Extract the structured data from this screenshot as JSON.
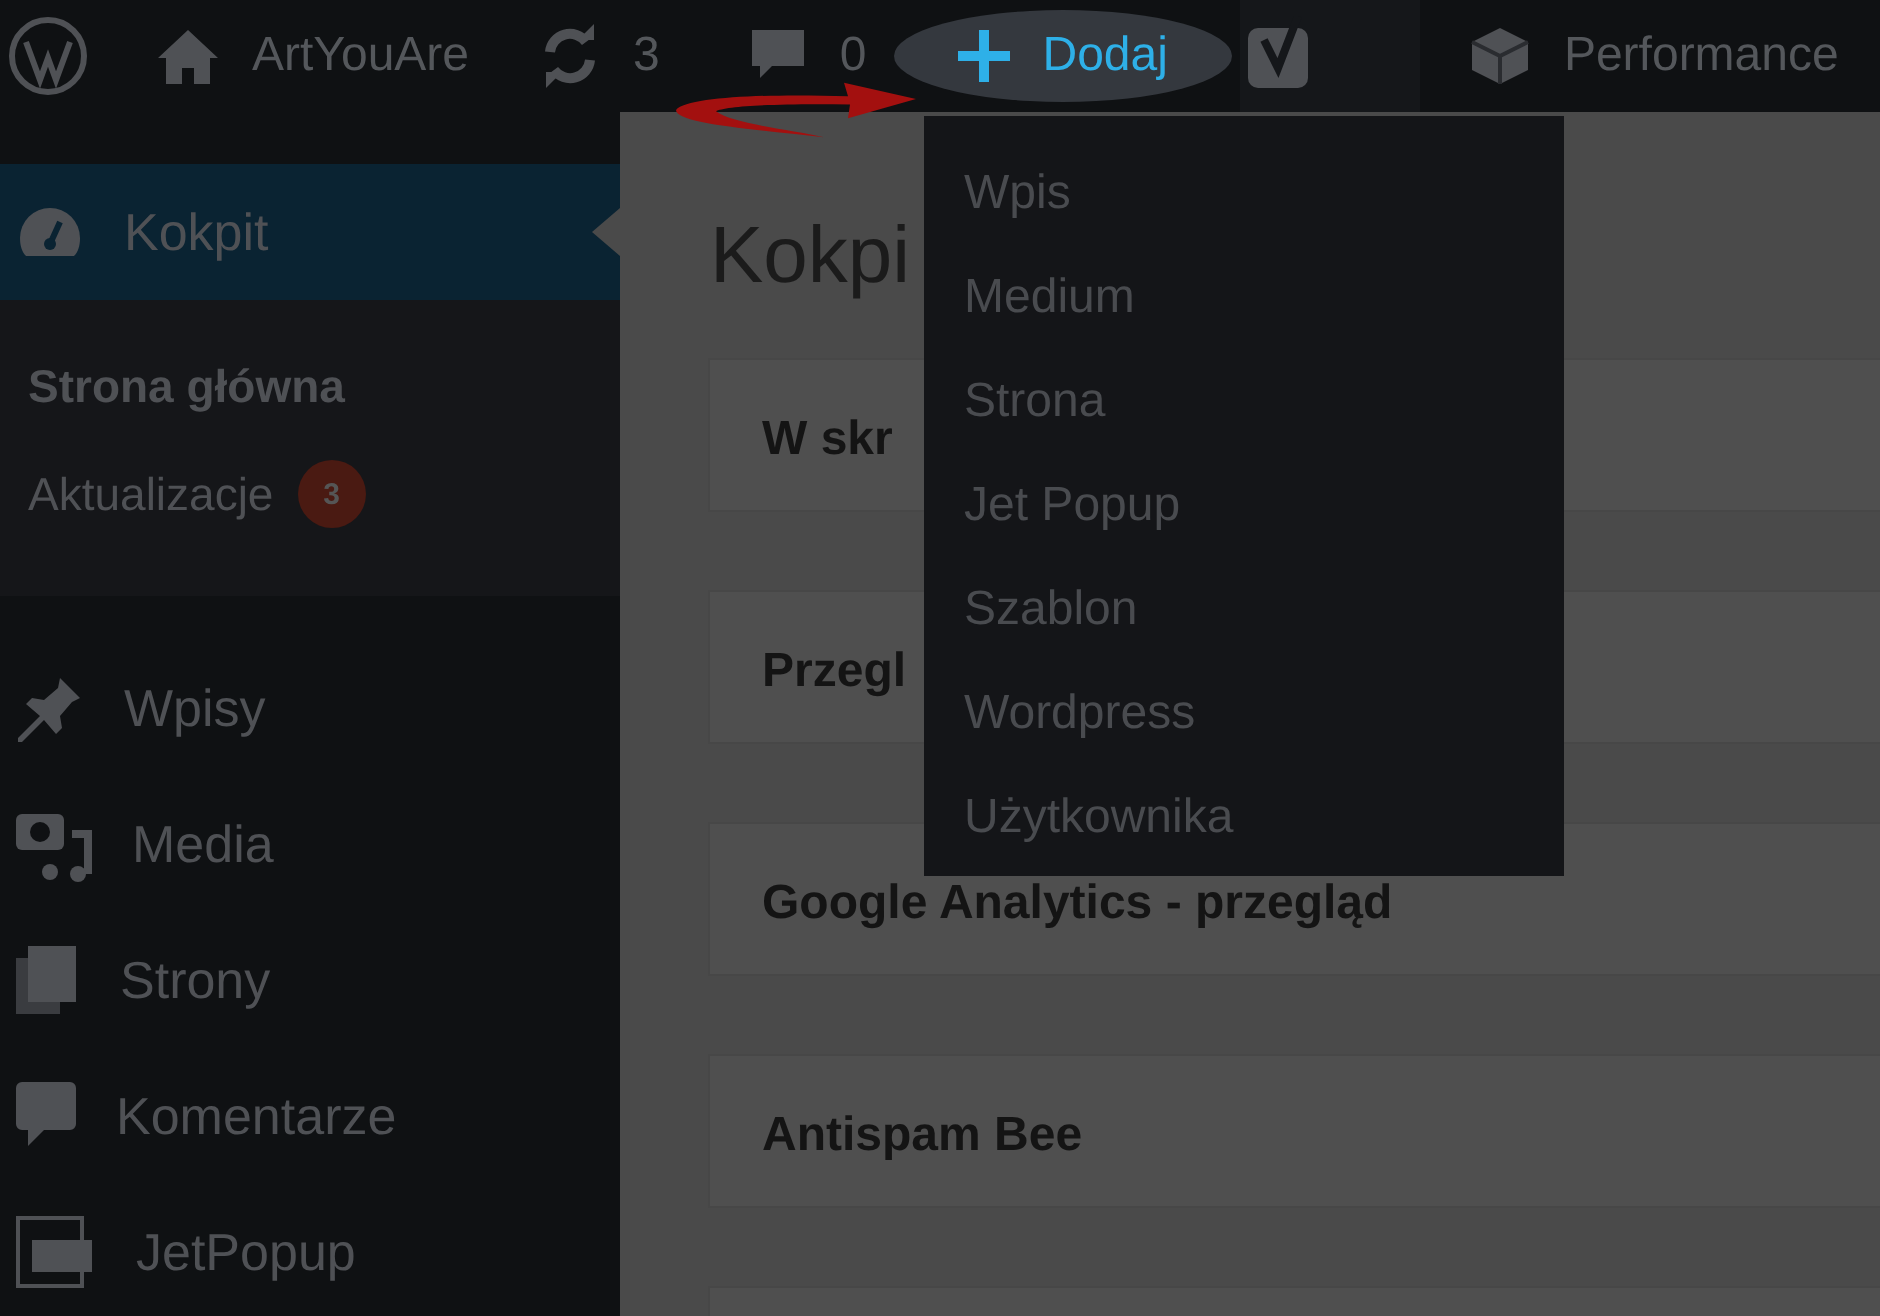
{
  "admin_bar": {
    "site_name": "ArtYouAre",
    "updates_count": "3",
    "comments_count": "0",
    "new_button": {
      "label": "Dodaj",
      "highlighted": true
    },
    "performance": "Performance"
  },
  "new_menu": {
    "items": [
      "Wpis",
      "Medium",
      "Strona",
      "Jet Popup",
      "Szablon",
      "Wordpress",
      "Użytkownika"
    ]
  },
  "sidebar": {
    "items": [
      {
        "label": "Kokpit",
        "selected": true,
        "submenu": [
          {
            "label": "Strona główna",
            "selected": true
          },
          {
            "label": "Aktualizacje",
            "selected": false,
            "badge": "3"
          }
        ]
      },
      {
        "label": "Wpisy",
        "selected": false
      },
      {
        "label": "Media",
        "selected": false
      },
      {
        "label": "Strony",
        "selected": false
      },
      {
        "label": "Komentarze",
        "selected": false
      },
      {
        "label": "JetPopup",
        "selected": false
      }
    ]
  },
  "page": {
    "title": "Kokpi",
    "cards": [
      "W skr",
      "Przegl",
      "Google Analytics - przegląd",
      "Antispam Bee"
    ]
  }
}
